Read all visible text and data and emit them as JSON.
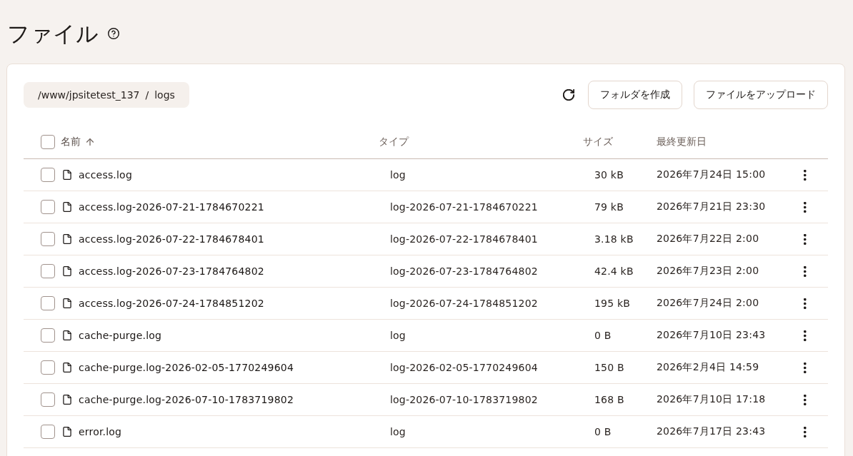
{
  "page": {
    "title": "ファイル"
  },
  "breadcrumb": {
    "segments": [
      "/www/jpsitetest_137",
      "logs"
    ],
    "separator": "/"
  },
  "toolbar": {
    "buttons": [
      {
        "label": "フォルダを作成"
      },
      {
        "label": "ファイルをアップロード"
      }
    ]
  },
  "table": {
    "select_all_checked": false,
    "columns": [
      {
        "label": "名前",
        "sorted": true,
        "descending": false
      },
      {
        "label": "タイプ",
        "sorted": false
      },
      {
        "label": "サイズ",
        "sorted": false
      },
      {
        "label": "最終更新日",
        "sorted": false
      }
    ],
    "rows": [
      {
        "name": "access.log",
        "type": "log",
        "size": "30 kB",
        "modified": "2026年7月24日 15:00",
        "checked": false
      },
      {
        "name": "access.log-2026-07-21-1784670221",
        "type": "log-2026-07-21-1784670221",
        "size": "79 kB",
        "modified": "2026年7月21日 23:30",
        "checked": false
      },
      {
        "name": "access.log-2026-07-22-1784678401",
        "type": "log-2026-07-22-1784678401",
        "size": "3.18 kB",
        "modified": "2026年7月22日 2:00",
        "checked": false
      },
      {
        "name": "access.log-2026-07-23-1784764802",
        "type": "log-2026-07-23-1784764802",
        "size": "42.4 kB",
        "modified": "2026年7月23日 2:00",
        "checked": false
      },
      {
        "name": "access.log-2026-07-24-1784851202",
        "type": "log-2026-07-24-1784851202",
        "size": "195 kB",
        "modified": "2026年7月24日 2:00",
        "checked": false
      },
      {
        "name": "cache-purge.log",
        "type": "log",
        "size": "0 B",
        "modified": "2026年7月10日 23:43",
        "checked": false
      },
      {
        "name": "cache-purge.log-2026-02-05-1770249604",
        "type": "log-2026-02-05-1770249604",
        "size": "150 B",
        "modified": "2026年2月4日 14:59",
        "checked": false
      },
      {
        "name": "cache-purge.log-2026-07-10-1783719802",
        "type": "log-2026-07-10-1783719802",
        "size": "168 B",
        "modified": "2026年7月10日 17:18",
        "checked": false
      },
      {
        "name": "error.log",
        "type": "log",
        "size": "0 B",
        "modified": "2026年7月17日 23:43",
        "checked": false
      }
    ]
  }
}
